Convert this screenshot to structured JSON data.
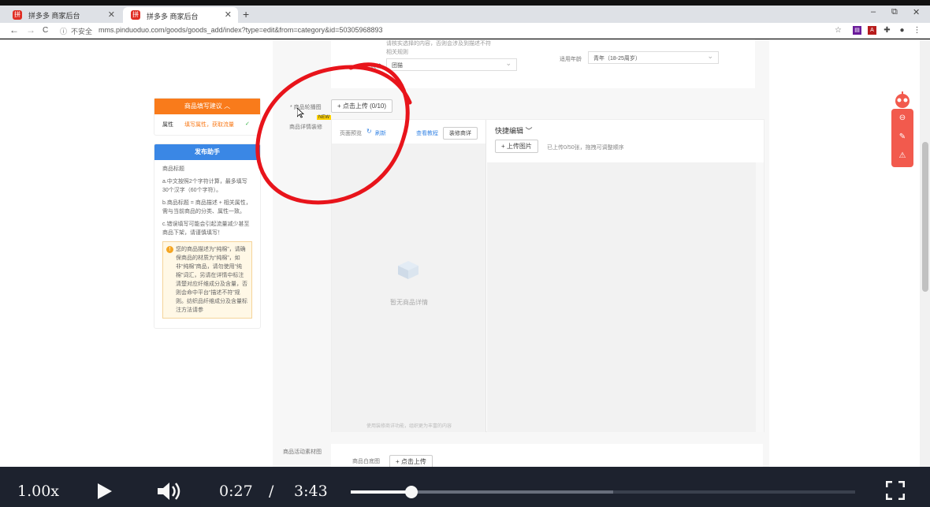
{
  "browser": {
    "tabs": [
      {
        "title": "拼多多 商家后台",
        "active": false
      },
      {
        "title": "拼多多 商家后台",
        "active": true
      }
    ],
    "new_tab": "+",
    "window_controls": [
      "–",
      "⧉",
      "✕"
    ],
    "nav": {
      "back": "←",
      "forward": "→",
      "reload": "C"
    },
    "security_label": "不安全",
    "url": "mms.pinduoduo.com/goods/goods_add/index?type=edit&from=category&id=50305968893"
  },
  "form_top": {
    "notice_line1": "请核实选择的内容，否则会涉及到描述不符",
    "notice_line2": "相关规则",
    "style_label": "风格",
    "style_value": "团猫",
    "age_label": "适用年龄",
    "age_value": "青年（18-25周岁）"
  },
  "suggest_card": {
    "title": "商品填写建议 ︿",
    "row_label": "属性",
    "row_value": "填写属性，获取流量",
    "row_check": "✓"
  },
  "assistant_card": {
    "title": "发布助手",
    "heading": "商品标题",
    "tips": [
      "a.中文按照2个字符计算，最多填写30个汉字（60个字符）。",
      "b.商品标题 = 商品描述 + 相关属性，需与当前商品的分类、属性一致。",
      "c.错误填写可能会引起流量减少甚至商品下架，请谨慎填写！"
    ],
    "warning": "您的商品描述为“纯棉”，请确保商品的材质为“纯棉”，如非“纯棉”商品，请勿使用“纯棉”词汇，另请在详情中标注清楚对应纤维成分及含量，否则会命中平台“描述不符”规则。纺织品纤维成分及含量标注方法请参"
  },
  "carousel": {
    "label": "* 商品轮播图",
    "upload_button": "+ 点击上传 (0/10)",
    "new_badge": "NEW"
  },
  "detail": {
    "label": "商品详情装修",
    "preview_label": "页面预览",
    "refresh_label": "刷新",
    "tutorial_link": "查看教程",
    "decorate_button": "装修商详",
    "empty_text": "暂无商品详情",
    "footer_hint": "使用装修商详功能，组织更为丰富的内容",
    "quick_edit": "快捷编辑 ﹀",
    "upload_images": "+ 上传图片",
    "upload_hint": "已上传0/50张，拖拽可调整顺序"
  },
  "material": {
    "section_label": "商品活动素材图",
    "white_bg_label": "商品白底图",
    "upload_button": "+ 点击上传"
  },
  "float_tools": [
    "⊖",
    "✎",
    "⚠"
  ],
  "player": {
    "speed": "1.00x",
    "play_icon": "play-icon",
    "volume_icon": "volume-icon",
    "current_time": "0:27",
    "separator": "/",
    "duration": "3:43",
    "progress_fraction": 0.121,
    "buffered_fraction": 0.52,
    "fullscreen_icon": "fullscreen-icon"
  },
  "colors": {
    "orange": "#f97b1b",
    "blue": "#3a87e5",
    "annotation_red": "#e8141b",
    "float_red": "#f25a4d"
  }
}
